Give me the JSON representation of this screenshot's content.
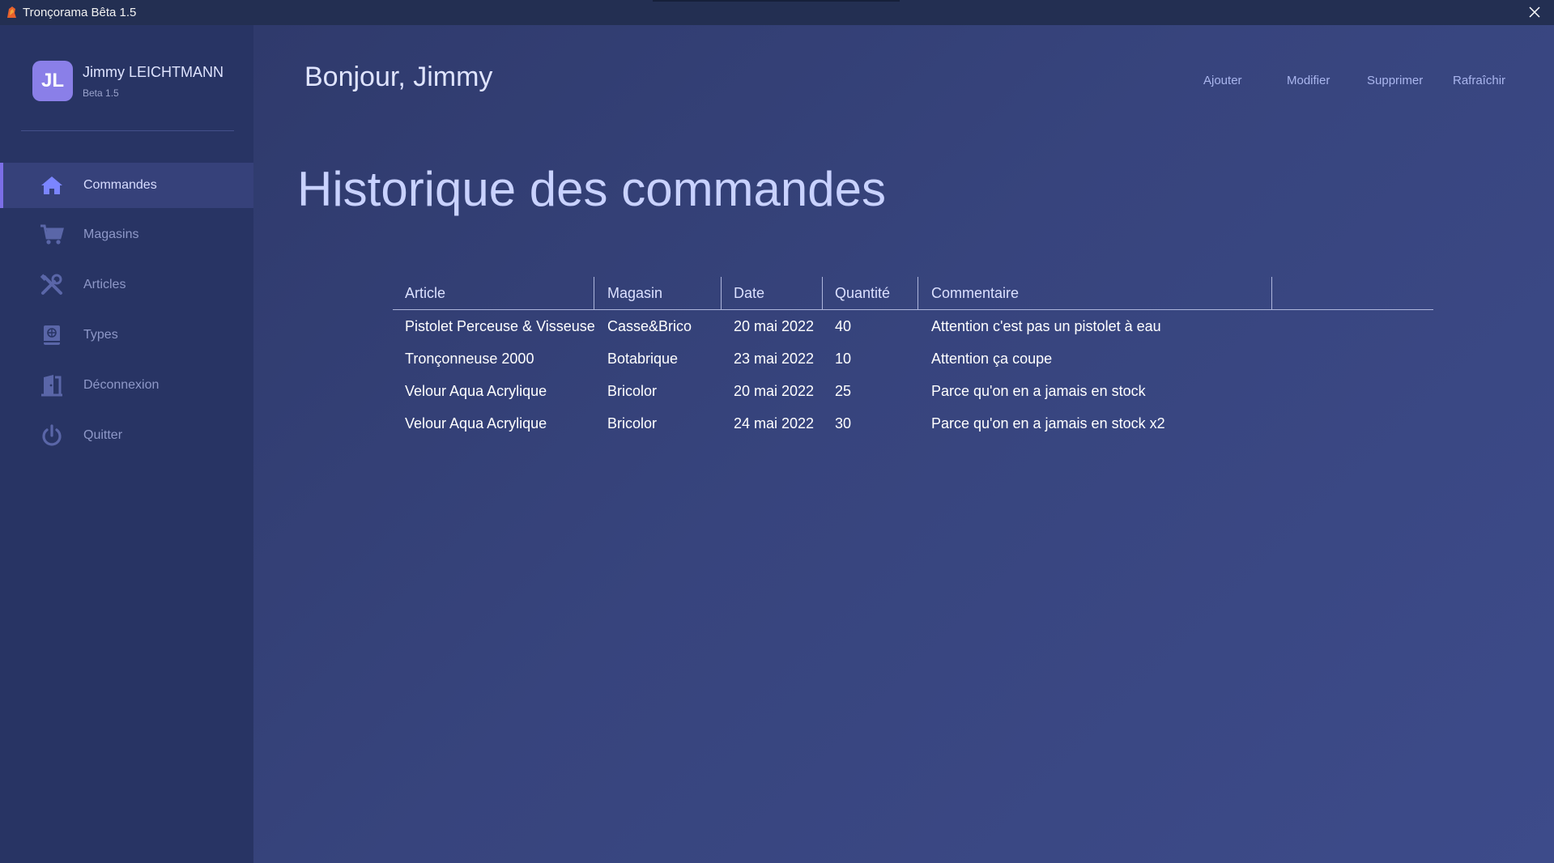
{
  "window": {
    "title": "Tronçorama Bêta 1.5"
  },
  "user": {
    "initials": "JL",
    "name": "Jimmy LEICHTMANN",
    "version": "Beta 1.5"
  },
  "sidebar": {
    "items": [
      {
        "label": "Commandes",
        "icon": "home-icon",
        "active": true
      },
      {
        "label": "Magasins",
        "icon": "cart-icon",
        "active": false
      },
      {
        "label": "Articles",
        "icon": "tools-icon",
        "active": false
      },
      {
        "label": "Types",
        "icon": "book-icon",
        "active": false
      },
      {
        "label": "Déconnexion",
        "icon": "door-icon",
        "active": false
      },
      {
        "label": "Quitter",
        "icon": "power-icon",
        "active": false
      }
    ]
  },
  "header": {
    "greeting": "Bonjour, Jimmy",
    "actions": {
      "add": "Ajouter",
      "edit": "Modifier",
      "delete": "Supprimer",
      "refresh": "Rafraîchir"
    }
  },
  "main": {
    "title": "Historique des commandes"
  },
  "table": {
    "columns": [
      "Article",
      "Magasin",
      "Date",
      "Quantité",
      "Commentaire"
    ],
    "rows": [
      [
        "Pistolet Perceuse & Visseuse",
        "Casse&Brico",
        "20 mai 2022",
        "40",
        "Attention c'est pas un pistolet à eau"
      ],
      [
        "Tronçonneuse 2000",
        "Botabrique",
        "23 mai 2022",
        "10",
        "Attention ça coupe"
      ],
      [
        "Velour Aqua Acrylique",
        "Bricolor",
        "20 mai 2022",
        "25",
        "Parce qu'on en a jamais en stock"
      ],
      [
        "Velour Aqua Acrylique",
        "Bricolor",
        "24 mai 2022",
        "30",
        "Parce qu'on en a jamais en stock x2"
      ]
    ]
  },
  "colors": {
    "accent": "#7b6ee6",
    "sidebar_bg": "#283464",
    "titlebar_bg": "#232f52",
    "icon_active": "#7b85ff",
    "icon_inactive": "#5a66a8"
  }
}
